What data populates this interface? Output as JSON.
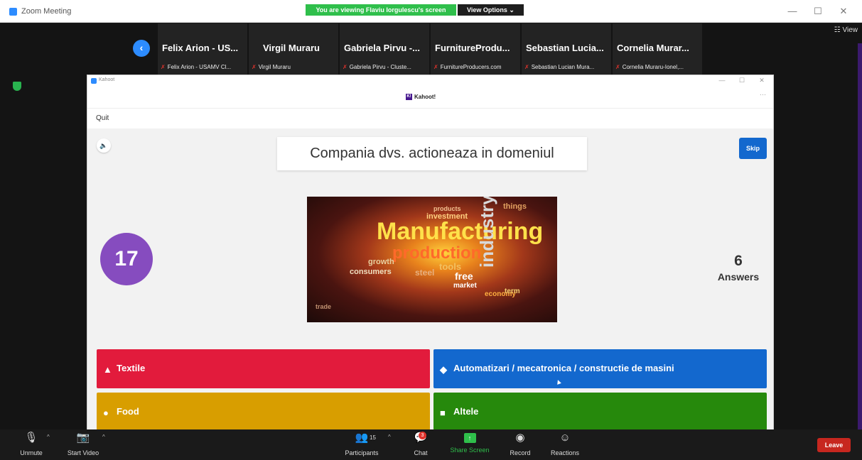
{
  "window": {
    "title": "Zoom Meeting",
    "minimize": "—",
    "maximize": "☐",
    "close": "✕"
  },
  "banner": {
    "viewing": "You are viewing Flaviu Iorgulescu's screen",
    "view_options": "View Options ⌄"
  },
  "view_button": "☷ View",
  "participants": [
    {
      "name": "Felix Arion - US...",
      "label": "Felix Arion - USAMV Cl..."
    },
    {
      "name": "Virgil Muraru",
      "label": "Virgil Muraru"
    },
    {
      "name": "Gabriela Pirvu -...",
      "label": "Gabriela Pirvu - Cluste..."
    },
    {
      "name": "FurnitureProdu...",
      "label": "FurnitureProducers.com"
    },
    {
      "name": "Sebastian Lucia...",
      "label": "Sebastian Lucian Mura..."
    },
    {
      "name": "Cornelia Murar...",
      "label": "Cornelia Muraru-Ionel,..."
    }
  ],
  "kahoot": {
    "window_title": "Kahoot",
    "logo": "Kahoot!",
    "logo_mark": "K!",
    "dots": "···",
    "quit": "Quit",
    "question": "Compania dvs. actioneaza in domeniul",
    "skip": "Skip",
    "timer": "17",
    "answers_count": "6",
    "answers_label": "Answers",
    "image_words": [
      "Manufacturing",
      "production",
      "industry",
      "growth",
      "consumers",
      "tools",
      "free",
      "market",
      "steel",
      "economy",
      "investment",
      "products",
      "things",
      "term",
      "trade"
    ],
    "answers": [
      {
        "shape": "▲",
        "text": "Textile",
        "color": "#e21b3c"
      },
      {
        "shape": "◆",
        "text": "Automatizari / mecatronica / constructie de masini",
        "color": "#1368ce"
      },
      {
        "shape": "●",
        "text": "Food",
        "color": "#d89e00"
      },
      {
        "shape": "■",
        "text": "Altele",
        "color": "#26890c"
      }
    ]
  },
  "toolbar": {
    "unmute": "Unmute",
    "start_video": "Start Video",
    "participants": "Participants",
    "participants_count": "15",
    "chat": "Chat",
    "chat_badge": "3",
    "share_screen": "Share Screen",
    "record": "Record",
    "reactions": "Reactions",
    "leave": "Leave"
  }
}
